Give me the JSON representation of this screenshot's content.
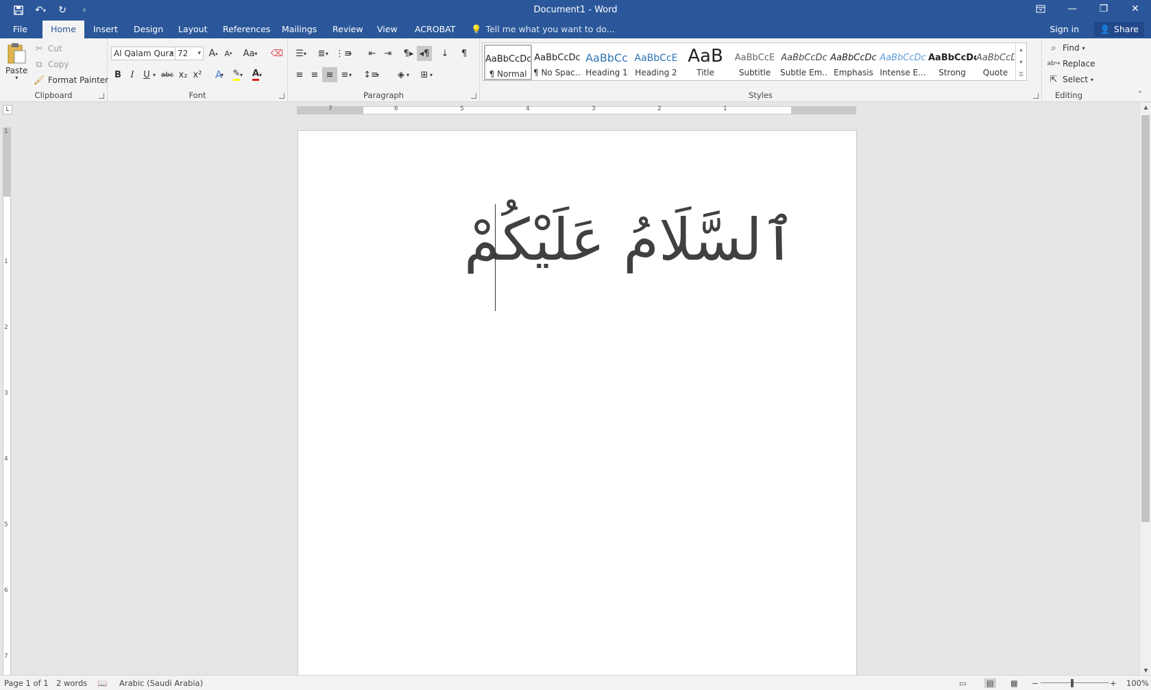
{
  "window": {
    "title": "Document1 - Word",
    "minimize_icon": "minimize-icon",
    "restore_icon": "restore-icon",
    "close_icon": "close-icon"
  },
  "quick_access": {
    "save_icon": "save-icon",
    "undo_icon": "undo-icon",
    "redo_icon": "redo-icon",
    "customize_icon": "customize-icon"
  },
  "tabs": [
    "File",
    "Home",
    "Insert",
    "Design",
    "Layout",
    "References",
    "Mailings",
    "Review",
    "View",
    "ACROBAT"
  ],
  "tell_me": "Tell me what you want to do...",
  "sign_in": "Sign in",
  "share": "Share",
  "clipboard": {
    "paste": "Paste",
    "cut": "Cut",
    "copy": "Copy",
    "format_painter": "Format Painter",
    "label": "Clipboard"
  },
  "font": {
    "name": "Al Qalam Qura",
    "size": "72",
    "label": "Font",
    "bold": "B",
    "italic": "I",
    "underline": "U",
    "strike": "abc",
    "subscript": "x₂",
    "superscript": "x²",
    "grow": "A",
    "shrink": "A",
    "case": "Aa"
  },
  "paragraph": {
    "label": "Paragraph",
    "pilcrow": "¶"
  },
  "styles": {
    "label": "Styles",
    "items": [
      {
        "preview": "AaBbCcDc",
        "name": "¶ Normal"
      },
      {
        "preview": "AaBbCcDc",
        "name": "¶ No Spac..."
      },
      {
        "preview": "AaBbCc",
        "name": "Heading 1"
      },
      {
        "preview": "AaBbCcE",
        "name": "Heading 2"
      },
      {
        "preview": "AaB",
        "name": "Title"
      },
      {
        "preview": "AaBbCcE",
        "name": "Subtitle"
      },
      {
        "preview": "AaBbCcDc",
        "name": "Subtle Em..."
      },
      {
        "preview": "AaBbCcDc",
        "name": "Emphasis"
      },
      {
        "preview": "AaBbCcDc",
        "name": "Intense E..."
      },
      {
        "preview": "AaBbCcDc",
        "name": "Strong"
      },
      {
        "preview": "AaBbCcDc",
        "name": "Quote"
      }
    ]
  },
  "editing": {
    "label": "Editing",
    "find": "Find",
    "replace": "Replace",
    "select": "Select"
  },
  "ruler": {
    "numbers": [
      "7",
      "6",
      "5",
      "4",
      "3",
      "2",
      "1"
    ],
    "vertical": [
      "1",
      "1",
      "2",
      "3",
      "4",
      "5",
      "6",
      "7"
    ]
  },
  "document": {
    "text": "ٱلسَّلَامُ عَلَيْكُمْ"
  },
  "status": {
    "page": "Page 1 of 1",
    "words": "2 words",
    "language": "Arabic (Saudi Arabia)",
    "zoom": "100%"
  },
  "colors": {
    "brand": "#2b579a",
    "ribbon": "#f3f3f3"
  }
}
